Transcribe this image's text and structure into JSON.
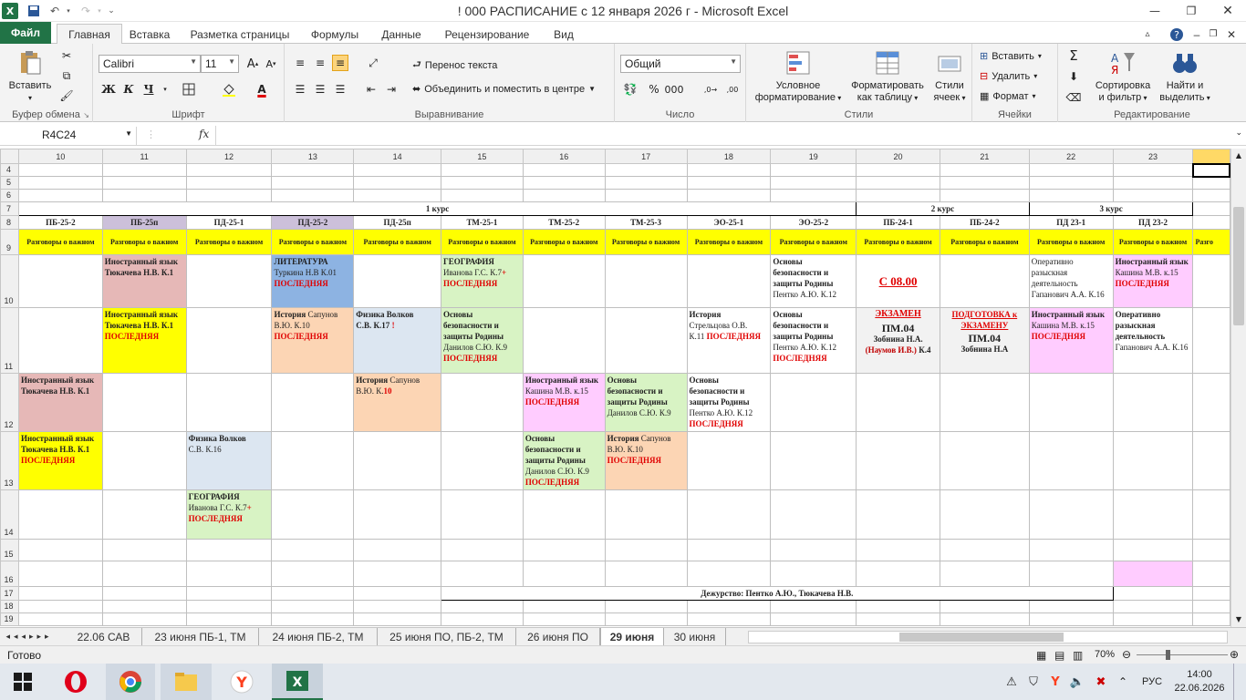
{
  "window": {
    "title": "! 000 РАСПИСАНИЕ с 12 января 2026 г  -  Microsoft Excel"
  },
  "ribbon": {
    "tabs": [
      "Файл",
      "Главная",
      "Вставка",
      "Разметка страницы",
      "Формулы",
      "Данные",
      "Рецензирование",
      "Вид"
    ],
    "clipboard": {
      "paste": "Вставить",
      "group": "Буфер обмена"
    },
    "font": {
      "name": "Calibri",
      "size": "11",
      "group": "Шрифт"
    },
    "alignment": {
      "wrap": "Перенос текста",
      "merge": "Объединить и поместить в центре",
      "group": "Выравнивание"
    },
    "number": {
      "format": "Общий",
      "group": "Число"
    },
    "styles": {
      "conditional": [
        "Условное",
        "форматирование"
      ],
      "table": [
        "Форматировать",
        "как таблицу"
      ],
      "cellstyles": [
        "Стили",
        "ячеек"
      ],
      "group": "Стили"
    },
    "cells": {
      "insert": "Вставить",
      "delete": "Удалить",
      "format": "Формат",
      "group": "Ячейки"
    },
    "editing": {
      "sort": [
        "Сортировка",
        "и фильтр"
      ],
      "find": [
        "Найти и",
        "выделить"
      ],
      "group": "Редактирование"
    }
  },
  "formula_bar": {
    "name_box": "R4C24",
    "fx": "fx",
    "value": ""
  },
  "sheet": {
    "col_numbers": [
      "10",
      "11",
      "12",
      "13",
      "14",
      "15",
      "16",
      "17",
      "18",
      "19",
      "20",
      "21",
      "22",
      "23",
      ""
    ],
    "row_numbers": [
      "4",
      "5",
      "6",
      "7",
      "8",
      "9",
      "10",
      "11",
      "12",
      "13",
      "14",
      "15",
      "16",
      "17",
      "18",
      "19"
    ],
    "course1": "1 курс",
    "course2": "2 курс",
    "course3": "3 курс",
    "groups": [
      "ПБ-25-2",
      "ПБ-25п",
      "ПД-25-1",
      "ПД-25-2",
      "ПД-25п",
      "ТМ-25-1",
      "ТМ-25-2",
      "ТМ-25-3",
      "ЭО-25-1",
      "ЭО-25-2",
      "ПБ-24-1",
      "ПБ-24-2",
      "ПД 23-1",
      "ПД 23-2",
      ""
    ],
    "talk": "Разговоры о важном",
    "talk_cut": "Разго",
    "last": "ПОСЛЕДНЯЯ",
    "c": {
      "r10_11a": "Иностранный язык",
      "r10_11b": "Тюкачева Н.В. К.1",
      "r10_13a": "ЛИТЕРАТУРА",
      "r10_13b": "Туркина Н.В К.01",
      "r10_15a": "ГЕОГРАФИЯ",
      "r10_15b": "Иванова Г.С. К.7",
      "r10_15c": "+",
      "r10_19a": "Основы",
      "r10_19b": "безопасности и",
      "r10_19c": "защиты Родины",
      "r10_19d": "Пентко А.Ю. К.12",
      "r10_20": "С 08.00",
      "r10_22a": "Оперативно",
      "r10_22b": "разыскная",
      "r10_22c": "деятельность",
      "r10_22d": "Гапанович А.А. К.16",
      "r10_23a": "Иностранный язык",
      "r10_23b": "Кашина М.В. к.15",
      "r11_11a": "Иностранный язык",
      "r11_11b": "Тюкачева Н.В. К.1",
      "r11_13a": "История",
      "r11_13b": "Сапунов",
      "r11_13c": "В.Ю. К.10",
      "r11_14a": "Физика   Волков",
      "r11_14b": "С.В. К.17",
      "r11_14c": "!",
      "r11_15a": "Основы",
      "r11_15b": "безопасности и",
      "r11_15c": "защиты Родины",
      "r11_15d": "Данилов С.Ю. К.9",
      "r11_18a": "История",
      "r11_18b": "Стрельцова О.В.",
      "r11_18c": "К.11",
      "r11_19a": "Основы",
      "r11_19b": "безопасности и",
      "r11_19c": "защиты Родины",
      "r11_19d": "Пентко А.Ю. К.12",
      "r11_20a": "ЭКЗАМЕН",
      "r11_20b": "ПМ.04",
      "r11_20c": "Зобнина Н.А.",
      "r11_20d": "(Наумов И.В.)",
      "r11_20e": "К.4",
      "r11_21a": "ПОДГОТОВКА к",
      "r11_21b": "ЭКЗАМЕНУ",
      "r11_21c": "ПМ.04",
      "r11_21d": "Зобнина Н.А",
      "r11_22a": "Иностранный язык",
      "r11_22b": "Кашина М.В. к.15",
      "r11_23a": "Оперативно",
      "r11_23b": "разыскная",
      "r11_23c": "деятельность",
      "r11_23d": "Гапанович А.А. К.16",
      "r12_10a": "Иностранный язык",
      "r12_10b": "Тюкачева Н.В. К.1",
      "r12_14a": "История",
      "r12_14b": "Сапунов",
      "r12_14c": "В.Ю. К.",
      "r12_14d": "10",
      "r12_16a": "Иностранный язык",
      "r12_16b": "Кашина М.В. к.15",
      "r12_17a": "Основы",
      "r12_17b": "безопасности и",
      "r12_17c": "защиты Родины",
      "r12_17d": "Данилов С.Ю. К.9",
      "r12_18a": "Основы",
      "r12_18b": "безопасности и",
      "r12_18c": "защиты Родины",
      "r12_18d": "Пентко А.Ю. К.12",
      "r13_10a": "Иностранный язык",
      "r13_10b": "Тюкачева Н.В. К.1",
      "r13_12a": "Физика   Волков",
      "r13_12b": "С.В. К.16",
      "r13_16a": "Основы",
      "r13_16b": "безопасности и",
      "r13_16c": "защиты Родины",
      "r13_16d": "Данилов С.Ю. К.9",
      "r13_17a": "История",
      "r13_17b": "Сапунов",
      "r13_17c": "В.Ю. К.10",
      "r14_12a": "ГЕОГРАФИЯ",
      "r14_12b": "Иванова Г.С. К.7",
      "r14_12c": "+",
      "duty": "Дежурство: Пентко А.Ю., Тюкачева Н.В."
    }
  },
  "sheet_tabs": [
    "22.06 САВ",
    "23 июня ПБ-1, ТМ",
    "24 июня ПБ-2, ТМ",
    "25 июня ПО, ПБ-2, ТМ",
    "26 июня ПО",
    "29 июня",
    "30 июня"
  ],
  "status": {
    "ready": "Готово",
    "zoom": "70%"
  },
  "taskbar": {
    "lang": "РУС",
    "time": "14:00",
    "date": "22.06.2026"
  },
  "colors": {
    "excel_green": "#217346",
    "yellow": "#ffff00",
    "red": "#e00000"
  }
}
